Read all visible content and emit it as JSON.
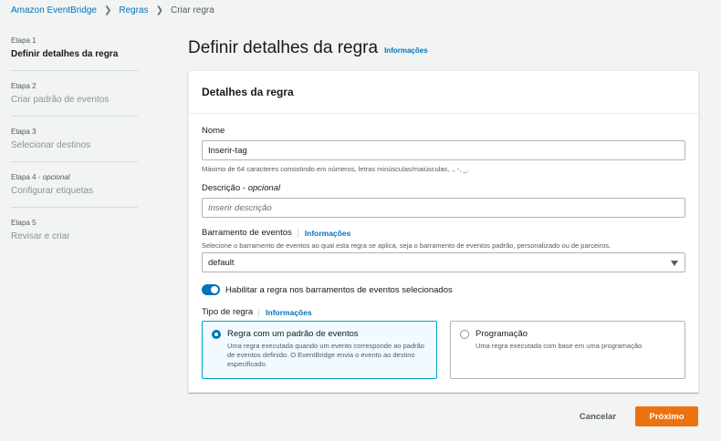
{
  "breadcrumb": {
    "items": [
      "Amazon EventBridge",
      "Regras"
    ],
    "current": "Criar regra"
  },
  "steps": [
    {
      "num": "Etapa 1",
      "title": "Definir detalhes da regra",
      "active": true
    },
    {
      "num": "Etapa 2",
      "title": "Criar padrão de eventos"
    },
    {
      "num": "Etapa 3",
      "title": "Selecionar destinos"
    },
    {
      "num": "Etapa 4",
      "num_suffix": "opcional",
      "title": "Configurar etiquetas"
    },
    {
      "num": "Etapa 5",
      "title": "Revisar e criar"
    }
  ],
  "page": {
    "title": "Definir detalhes da regra",
    "info": "Informações"
  },
  "panel": {
    "header": "Detalhes da regra",
    "name": {
      "label": "Nome",
      "value": "Inserir-tag",
      "hint": "Máximo de 64 caracteres consistindo em números, letras minúsculas/maiúsculas, ., -, _."
    },
    "description": {
      "label": "Descrição",
      "label_suffix": "opcional",
      "placeholder": "Inserir descrição"
    },
    "event_bus": {
      "label": "Barramento de eventos",
      "info": "Informações",
      "hint": "Selecione o barramento de eventos ao qual esta regra se aplica, seja o barramento de eventos padrão, personalizado ou de parceiros.",
      "value": "default"
    },
    "toggle": {
      "label": "Habilitar a regra nos barramentos de eventos selecionados",
      "on": true
    },
    "rule_type": {
      "label": "Tipo de regra",
      "info": "Informações",
      "options": [
        {
          "title": "Regra com um padrão de eventos",
          "desc": "Uma regra executada quando um evento corresponde ao padrão de eventos definido. O EventBridge envia o evento ao destino especificado.",
          "selected": true
        },
        {
          "title": "Programação",
          "desc": "Uma regra executada com base em uma programação",
          "selected": false
        }
      ]
    }
  },
  "footer": {
    "cancel": "Cancelar",
    "next": "Próximo"
  },
  "colors": {
    "link": "#0073bb",
    "primary_button": "#ec7211",
    "selected_tile_border": "#00a1c9"
  }
}
